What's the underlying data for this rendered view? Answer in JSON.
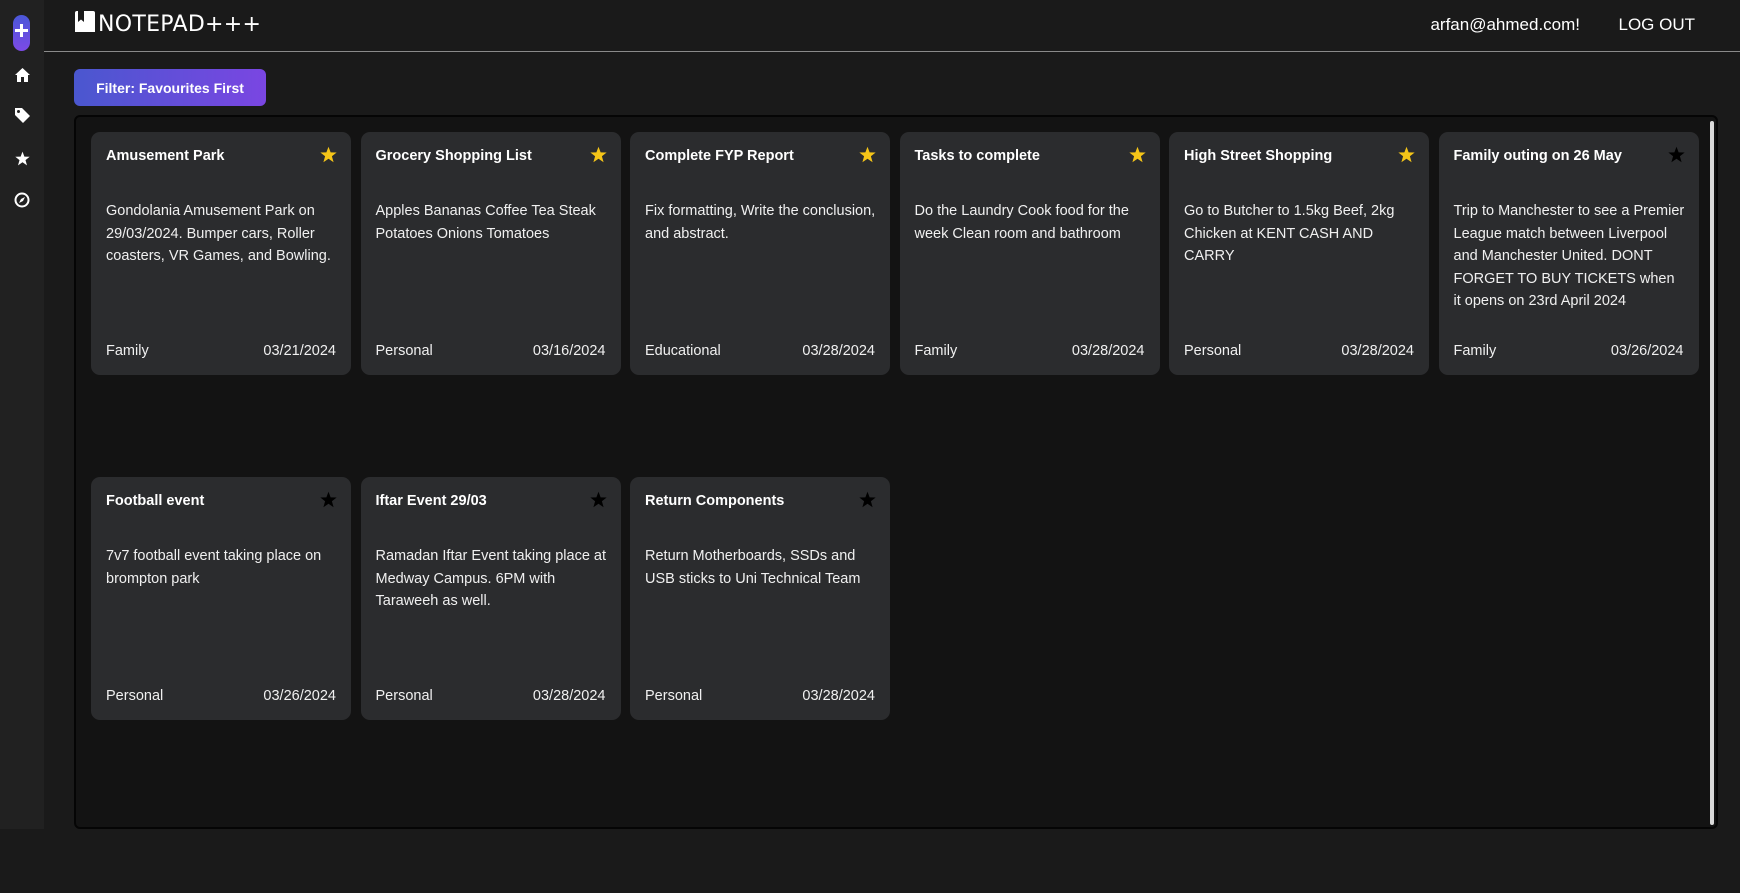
{
  "app": {
    "name": "NOTEPAD+++",
    "accent_start": "#4a57cf",
    "accent_end": "#7a46e2"
  },
  "sidebar": {
    "items": [
      {
        "icon": "plus-icon",
        "label": "Add note"
      },
      {
        "icon": "home-icon",
        "label": "Home"
      },
      {
        "icon": "tag-icon",
        "label": "Tags"
      },
      {
        "icon": "star-icon",
        "label": "Favourites"
      },
      {
        "icon": "compass-icon",
        "label": "Explore"
      }
    ]
  },
  "header": {
    "user_email": "arfan@ahmed.com!",
    "logout_label": "LOG OUT"
  },
  "filter": {
    "label": "Filter: Favourites First"
  },
  "colors": {
    "star_favourite": "#f5c518",
    "star_default": "#000000",
    "card_bg": "#2b2c2e"
  },
  "notes": [
    {
      "title": "Amusement Park",
      "favourite": true,
      "body": "Gondolania Amusement Park on 29/03/2024. Bumper cars, Roller coasters, VR Games, and Bowling.",
      "category": "Family",
      "date": "03/21/2024"
    },
    {
      "title": "Grocery Shopping List",
      "favourite": true,
      "body": "Apples Bananas Coffee Tea Steak Potatoes Onions Tomatoes",
      "category": "Personal",
      "date": "03/16/2024"
    },
    {
      "title": "Complete FYP Report",
      "favourite": true,
      "body": "Fix formatting, Write the conclusion, and abstract.",
      "category": "Educational",
      "date": "03/28/2024"
    },
    {
      "title": "Tasks to complete",
      "favourite": true,
      "body": "Do the Laundry Cook food for the week Clean room and bathroom",
      "category": "Family",
      "date": "03/28/2024"
    },
    {
      "title": "High Street Shopping",
      "favourite": true,
      "body": "Go to Butcher to 1.5kg Beef, 2kg Chicken at KENT CASH AND CARRY",
      "category": "Personal",
      "date": "03/28/2024"
    },
    {
      "title": "Family outing on 26 May",
      "favourite": false,
      "body": "Trip to Manchester to see a Premier League match between Liverpool and Manchester United. DONT FORGET TO BUY TICKETS when it opens on 23rd April 2024",
      "category": "Family",
      "date": "03/26/2024"
    },
    {
      "title": "Football event",
      "favourite": false,
      "body": "7v7 football event taking place on brompton park",
      "category": "Personal",
      "date": "03/26/2024"
    },
    {
      "title": "Iftar Event 29/03",
      "favourite": false,
      "body": "Ramadan Iftar Event taking place at Medway Campus. 6PM with Taraweeh as well.",
      "category": "Personal",
      "date": "03/28/2024"
    },
    {
      "title": "Return Components",
      "favourite": false,
      "body": "Return Motherboards, SSDs and USB sticks to Uni Technical Team",
      "category": "Personal",
      "date": "03/28/2024"
    }
  ]
}
